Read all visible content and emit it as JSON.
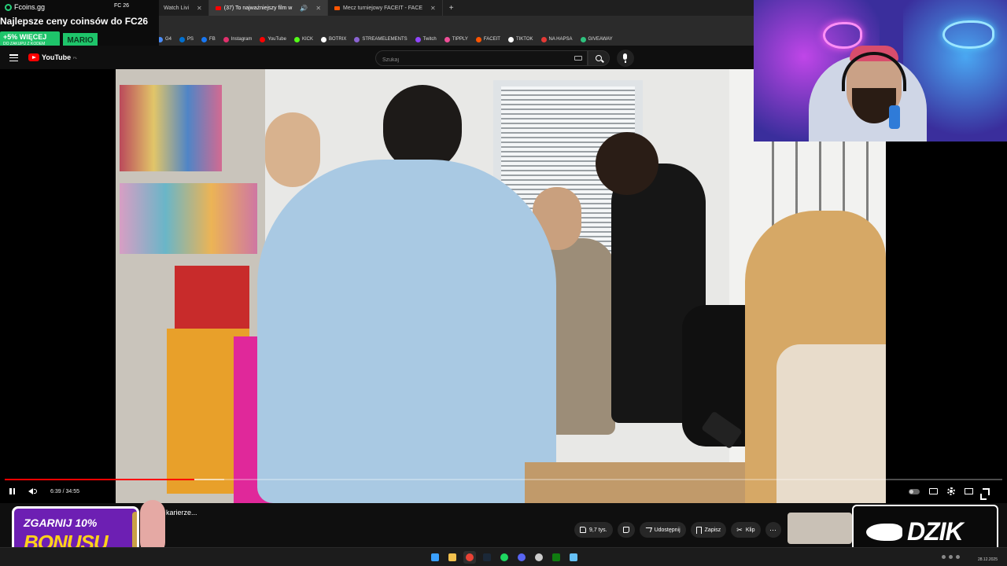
{
  "browser": {
    "tabs": [
      {
        "label": "Watch Livi",
        "active": false
      },
      {
        "label": "(37) To najważniejszy film w",
        "active": true
      },
      {
        "label": "Mecz turniejowy FACEIT - FACE",
        "active": false
      }
    ],
    "new_tab": "+",
    "bookmarks": [
      "G4",
      "PS",
      "FB",
      "Instagram",
      "YouTube",
      "KICK",
      "BOTRIX",
      "STREAMELEMENTS",
      "Twitch",
      "TIPPLY",
      "FACEIT",
      "TIKTOK",
      "NA HAPSA",
      "GIVEAWAY"
    ],
    "bookmark_colors": [
      "#4a8cf7",
      "#0070d1",
      "#1877f2",
      "#e1306c",
      "#ff0000",
      "#53fc18",
      "#ffffff",
      "#8a63d2",
      "#9146ff",
      "#f04e98",
      "#ff5500",
      "#ffffff",
      "#e53935",
      "#2ec27e"
    ]
  },
  "promo": {
    "brand": "Fcoins.gg",
    "fc_label": "FC 26",
    "headline": "Najlepsze ceny coinsów do FC26",
    "more_big": "+5% WIĘCEJ",
    "more_small": "DO ZAKUPU Z KODEM",
    "code": "MARIO",
    "accent": "#1ec46a"
  },
  "youtube": {
    "logo_text": "YouTube",
    "logo_sup": "PL",
    "search_placeholder": "Szukaj"
  },
  "player": {
    "time_display": "6:39 / 34:55",
    "progress": 0.19,
    "buffered": 0.22,
    "accent": "#ff0000"
  },
  "below": {
    "title": "...oszej karierze...",
    "like_count": "9,7 tys.",
    "share_label": "Udostępnij",
    "save_label": "Zapisz",
    "clip_label": "Klip",
    "more_label": "⋯"
  },
  "bonus": {
    "line1": "ZGARNIJ 10%",
    "line2": "BONUSU",
    "bg_color": "#6d1fb3",
    "text_color": "#ffd21a"
  },
  "dzik": {
    "text": "DZIK"
  },
  "taskbar": {
    "apps": [
      {
        "name": "windows-start-icon",
        "color": "#3aa0ff"
      },
      {
        "name": "file-explorer-icon",
        "color": "#f2c14e"
      },
      {
        "name": "chrome-icon",
        "color": "#e94235"
      },
      {
        "name": "steam-icon",
        "color": "#1b2838"
      },
      {
        "name": "spotify-icon",
        "color": "#1ed760"
      },
      {
        "name": "discord-icon",
        "color": "#5865f2"
      },
      {
        "name": "obs-icon",
        "color": "#cccccc"
      },
      {
        "name": "xbox-icon",
        "color": "#107c10"
      },
      {
        "name": "steam-2-icon",
        "color": "#66c0f4"
      }
    ],
    "date": "28.12.2025"
  }
}
